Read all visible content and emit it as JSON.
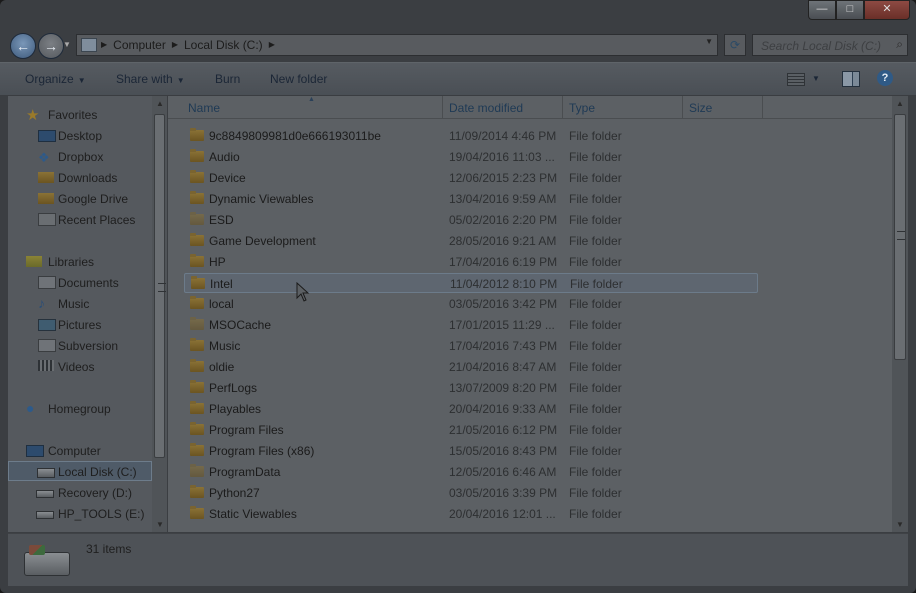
{
  "window": {
    "caption_buttons": {
      "minimize": "—",
      "maximize": "□",
      "close": "✕"
    }
  },
  "address": {
    "crumbs": [
      "Computer",
      "Local Disk (C:)"
    ],
    "search_placeholder": "Search Local Disk (C:)"
  },
  "toolbar": {
    "organize": "Organize",
    "share_with": "Share with",
    "burn": "Burn",
    "new_folder": "New folder"
  },
  "sidebar": {
    "favorites": "Favorites",
    "fav_items": [
      "Desktop",
      "Dropbox",
      "Downloads",
      "Google Drive",
      "Recent Places"
    ],
    "libraries": "Libraries",
    "lib_items": [
      "Documents",
      "Music",
      "Pictures",
      "Subversion",
      "Videos"
    ],
    "homegroup": "Homegroup",
    "computer": "Computer",
    "drives": [
      "Local Disk (C:)",
      "Recovery (D:)",
      "HP_TOOLS (E:)"
    ]
  },
  "columns": {
    "name": "Name",
    "date": "Date modified",
    "type": "Type",
    "size": "Size"
  },
  "rows": [
    {
      "name": "9c8849809981d0e666193011be",
      "date": "11/09/2014 4:46 PM",
      "type": "File folder"
    },
    {
      "name": "Audio",
      "date": "19/04/2016 11:03 ...",
      "type": "File folder"
    },
    {
      "name": "Device",
      "date": "12/06/2015 2:23 PM",
      "type": "File folder"
    },
    {
      "name": "Dynamic Viewables",
      "date": "13/04/2016 9:59 AM",
      "type": "File folder"
    },
    {
      "name": "ESD",
      "date": "05/02/2016 2:20 PM",
      "type": "File folder"
    },
    {
      "name": "Game Development",
      "date": "28/05/2016 9:21 AM",
      "type": "File folder"
    },
    {
      "name": "HP",
      "date": "17/04/2016 6:19 PM",
      "type": "File folder"
    },
    {
      "name": "Intel",
      "date": "11/04/2012 8:10 PM",
      "type": "File folder"
    },
    {
      "name": "local",
      "date": "03/05/2016 3:42 PM",
      "type": "File folder"
    },
    {
      "name": "MSOCache",
      "date": "17/01/2015 11:29 ...",
      "type": "File folder"
    },
    {
      "name": "Music",
      "date": "17/04/2016 7:43 PM",
      "type": "File folder"
    },
    {
      "name": "oldie",
      "date": "21/04/2016 8:47 AM",
      "type": "File folder"
    },
    {
      "name": "PerfLogs",
      "date": "13/07/2009 8:20 PM",
      "type": "File folder"
    },
    {
      "name": "Playables",
      "date": "20/04/2016 9:33 AM",
      "type": "File folder"
    },
    {
      "name": "Program Files",
      "date": "21/05/2016 6:12 PM",
      "type": "File folder"
    },
    {
      "name": "Program Files (x86)",
      "date": "15/05/2016 8:43 PM",
      "type": "File folder"
    },
    {
      "name": "ProgramData",
      "date": "12/05/2016 6:46 AM",
      "type": "File folder"
    },
    {
      "name": "Python27",
      "date": "03/05/2016 3:39 PM",
      "type": "File folder"
    },
    {
      "name": "Static Viewables",
      "date": "20/04/2016 12:01 ...",
      "type": "File folder"
    }
  ],
  "status": {
    "count": "31 items"
  }
}
